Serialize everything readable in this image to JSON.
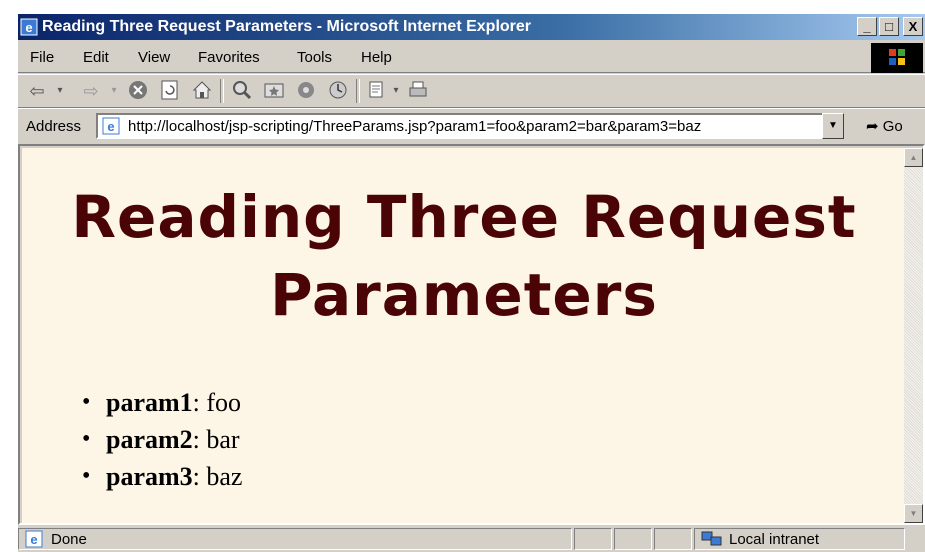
{
  "window": {
    "title": "Reading Three Request Parameters - Microsoft Internet Explorer",
    "minimize": "_",
    "maximize": "□",
    "close": "X"
  },
  "menu": [
    "File",
    "Edit",
    "View",
    "Favorites",
    "Tools",
    "Help"
  ],
  "toolbar": {
    "icons": [
      "back-icon",
      "forward-icon",
      "stop-icon",
      "refresh-icon",
      "home-icon",
      "search-icon",
      "favorites-icon",
      "media-icon",
      "history-icon",
      "mail-icon",
      "print-icon"
    ]
  },
  "address": {
    "label": "Address",
    "url": "http://localhost/jsp-scripting/ThreeParams.jsp?param1=foo&param2=bar&param3=baz",
    "go": "Go"
  },
  "page": {
    "heading": "Reading Three Request Parameters",
    "params": [
      {
        "name": "param1",
        "value": ": foo"
      },
      {
        "name": "param2",
        "value": ": bar"
      },
      {
        "name": "param3",
        "value": ": baz"
      }
    ]
  },
  "status": {
    "text": "Done",
    "zone": "Local intranet"
  },
  "colors": {
    "heading": "#4a0406",
    "page_background": "#fdf5e6",
    "titlebar_start": "#0a246a"
  }
}
